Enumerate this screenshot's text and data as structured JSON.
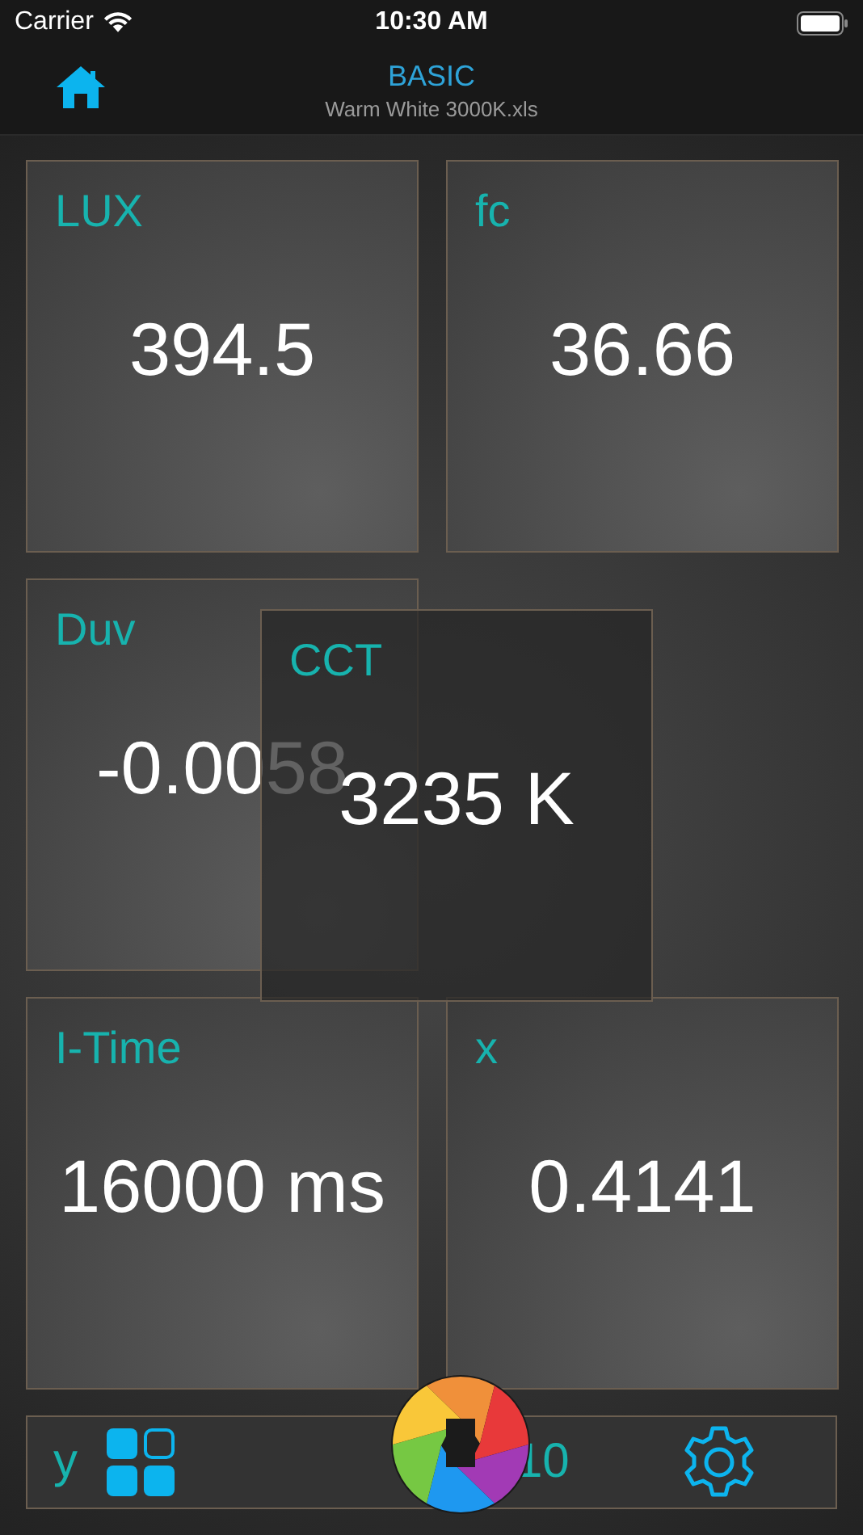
{
  "status_bar": {
    "carrier": "Carrier",
    "time": "10:30 AM"
  },
  "nav": {
    "title": "BASIC",
    "subtitle": "Warm White 3000K.xls"
  },
  "tile_rows": [
    [
      {
        "label": "LUX",
        "value": "394.5"
      },
      {
        "label": "fc",
        "value": "36.66"
      }
    ],
    [
      {
        "label": "Duv",
        "value": "-0.00",
        "covered_value": "58"
      }
    ],
    [
      {
        "label": "I-Time",
        "value": "16000 ms"
      },
      {
        "label": "x",
        "value": "0.4141"
      }
    ]
  ],
  "overlay_tile": {
    "label": "CCT",
    "value": "3235 K"
  },
  "bottom_bar": {
    "left_label": "y",
    "right_label": "10"
  }
}
